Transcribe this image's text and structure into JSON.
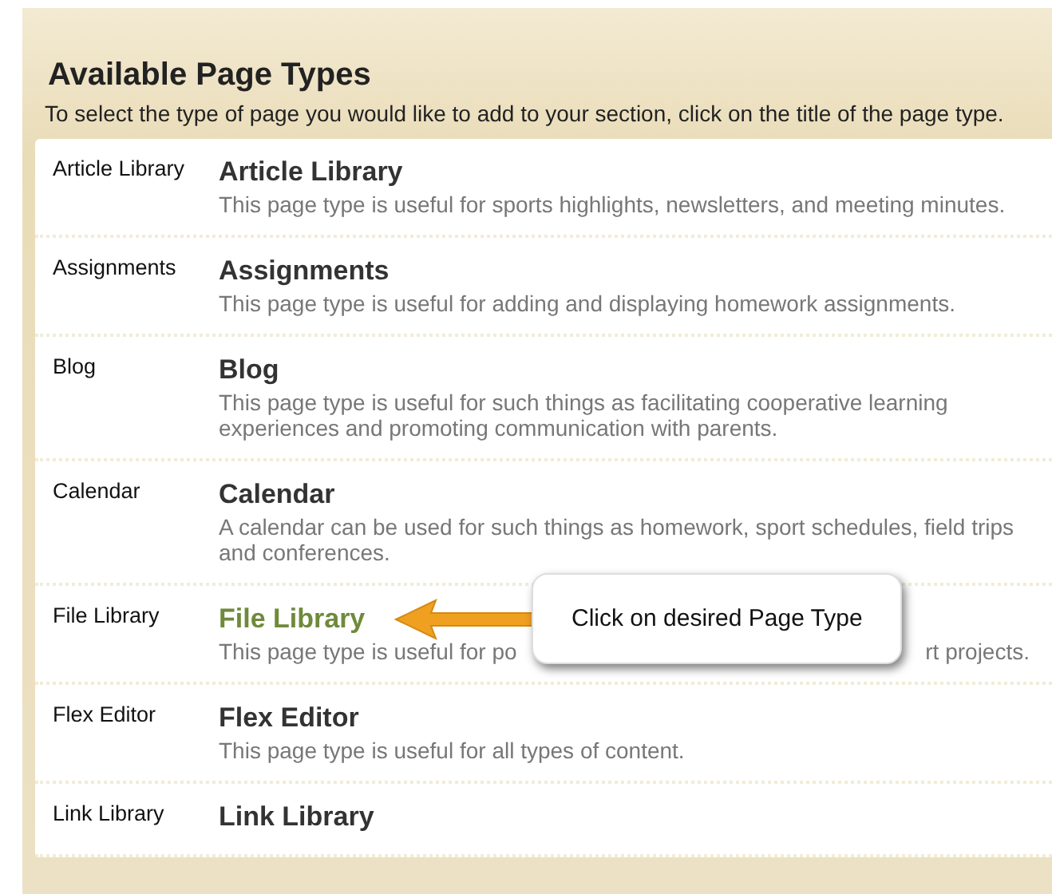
{
  "panel": {
    "title": "Available Page Types",
    "instructions": "To select the type of page you would like to add to your section, click on the title of the page type."
  },
  "page_types": [
    {
      "label": "Article Library",
      "title": "Article Library",
      "description": [
        "This page type is useful for sports highlights, newsletters, and meeting minutes."
      ],
      "highlighted": false
    },
    {
      "label": "Assignments",
      "title": "Assignments",
      "description": [
        "This page type is useful for adding and displaying homework assignments."
      ],
      "highlighted": false
    },
    {
      "label": "Blog",
      "title": "Blog",
      "description": [
        "This page type is useful for such things as facilitating cooperative learning experiences and promoting communication with parents."
      ],
      "highlighted": false
    },
    {
      "label": "Calendar",
      "title": "Calendar",
      "description": [
        "A calendar can be used for such things as homework, sport schedules, field trips and conferences."
      ],
      "highlighted": false
    },
    {
      "label": "File Library",
      "title": "File Library",
      "description": [
        "This page type is useful for po",
        "rt projects."
      ],
      "highlighted": true,
      "callout": "Click on desired Page Type"
    },
    {
      "label": "Flex Editor",
      "title": "Flex Editor",
      "description": [
        "This page type is useful for all types of content."
      ],
      "highlighted": false
    },
    {
      "label": "Link Library",
      "title": "Link Library",
      "highlighted": false
    }
  ]
}
